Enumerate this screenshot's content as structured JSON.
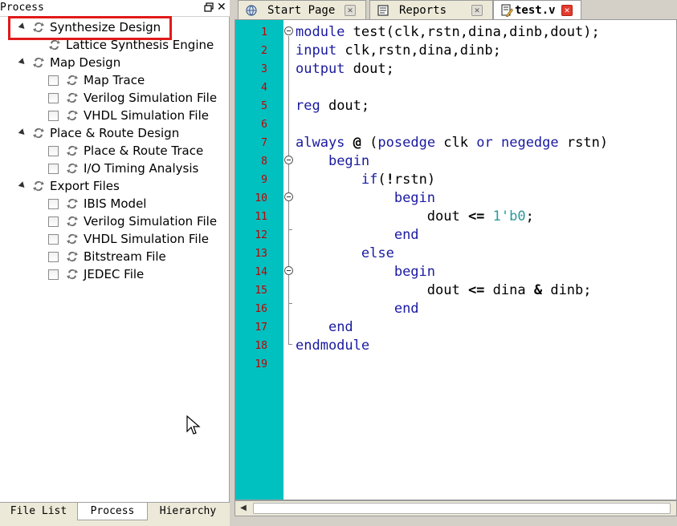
{
  "panel": {
    "title": "Process",
    "float_icon": "float-window-icon",
    "close_label": "✕"
  },
  "tree": {
    "items": [
      {
        "label": "Synthesize Design",
        "level": 0,
        "expanded": true,
        "icon": "sync-icon"
      },
      {
        "label": "Lattice Synthesis Engine",
        "level": 1,
        "icon": "sync-icon"
      },
      {
        "label": "Map Design",
        "level": 0,
        "expanded": true,
        "icon": "sync-icon"
      },
      {
        "label": "Map Trace",
        "level": 1,
        "checkbox": true,
        "icon": "sync-icon"
      },
      {
        "label": "Verilog Simulation File",
        "level": 1,
        "checkbox": true,
        "icon": "sync-icon"
      },
      {
        "label": "VHDL Simulation File",
        "level": 1,
        "checkbox": true,
        "icon": "sync-icon"
      },
      {
        "label": "Place & Route Design",
        "level": 0,
        "expanded": true,
        "icon": "sync-icon"
      },
      {
        "label": "Place & Route Trace",
        "level": 1,
        "checkbox": true,
        "icon": "sync-icon"
      },
      {
        "label": "I/O Timing Analysis",
        "level": 1,
        "checkbox": true,
        "icon": "sync-icon"
      },
      {
        "label": "Export Files",
        "level": 0,
        "expanded": true,
        "icon": "sync-icon"
      },
      {
        "label": "IBIS Model",
        "level": 1,
        "checkbox": true,
        "icon": "sync-icon"
      },
      {
        "label": "Verilog Simulation File",
        "level": 1,
        "checkbox": true,
        "icon": "sync-icon"
      },
      {
        "label": "VHDL Simulation File",
        "level": 1,
        "checkbox": true,
        "icon": "sync-icon"
      },
      {
        "label": "Bitstream File",
        "level": 1,
        "checkbox": true,
        "icon": "sync-icon"
      },
      {
        "label": "JEDEC File",
        "level": 1,
        "checkbox": true,
        "icon": "sync-icon"
      }
    ]
  },
  "bottom_tabs": [
    {
      "label": "File List"
    },
    {
      "label": "Process",
      "active": true
    },
    {
      "label": "Hierarchy"
    }
  ],
  "editor_tabs": [
    {
      "label": "Start Page",
      "icon": "start-page-icon"
    },
    {
      "label": "Reports",
      "icon": "reports-icon"
    },
    {
      "label": "test.v",
      "icon": "edit-file-icon",
      "active": true
    }
  ],
  "code": {
    "line_numbers": [
      "1",
      "2",
      "3",
      "4",
      "5",
      "6",
      "7",
      "8",
      "9",
      "10",
      "11",
      "12",
      "13",
      "14",
      "15",
      "16",
      "17",
      "18",
      "19"
    ],
    "lines": [
      "module test(clk,rstn,dina,dinb,dout);",
      "input clk,rstn,dina,dinb;",
      "output dout;",
      "",
      "reg dout;",
      "",
      "always @ (posedge clk or negedge rstn)",
      "    begin",
      "        if(!rstn)",
      "            begin",
      "                dout <= 1'b0;",
      "            end",
      "        else",
      "            begin",
      "                dout <= dina & dinb;",
      "            end",
      "    end",
      "endmodule",
      ""
    ]
  },
  "colors": {
    "gutter": "#00c0c0",
    "line_number": "#c00000",
    "keyword": "#1a1aa0",
    "number_literal": "#2a9a9a",
    "highlight_box": "#e11a1a"
  }
}
